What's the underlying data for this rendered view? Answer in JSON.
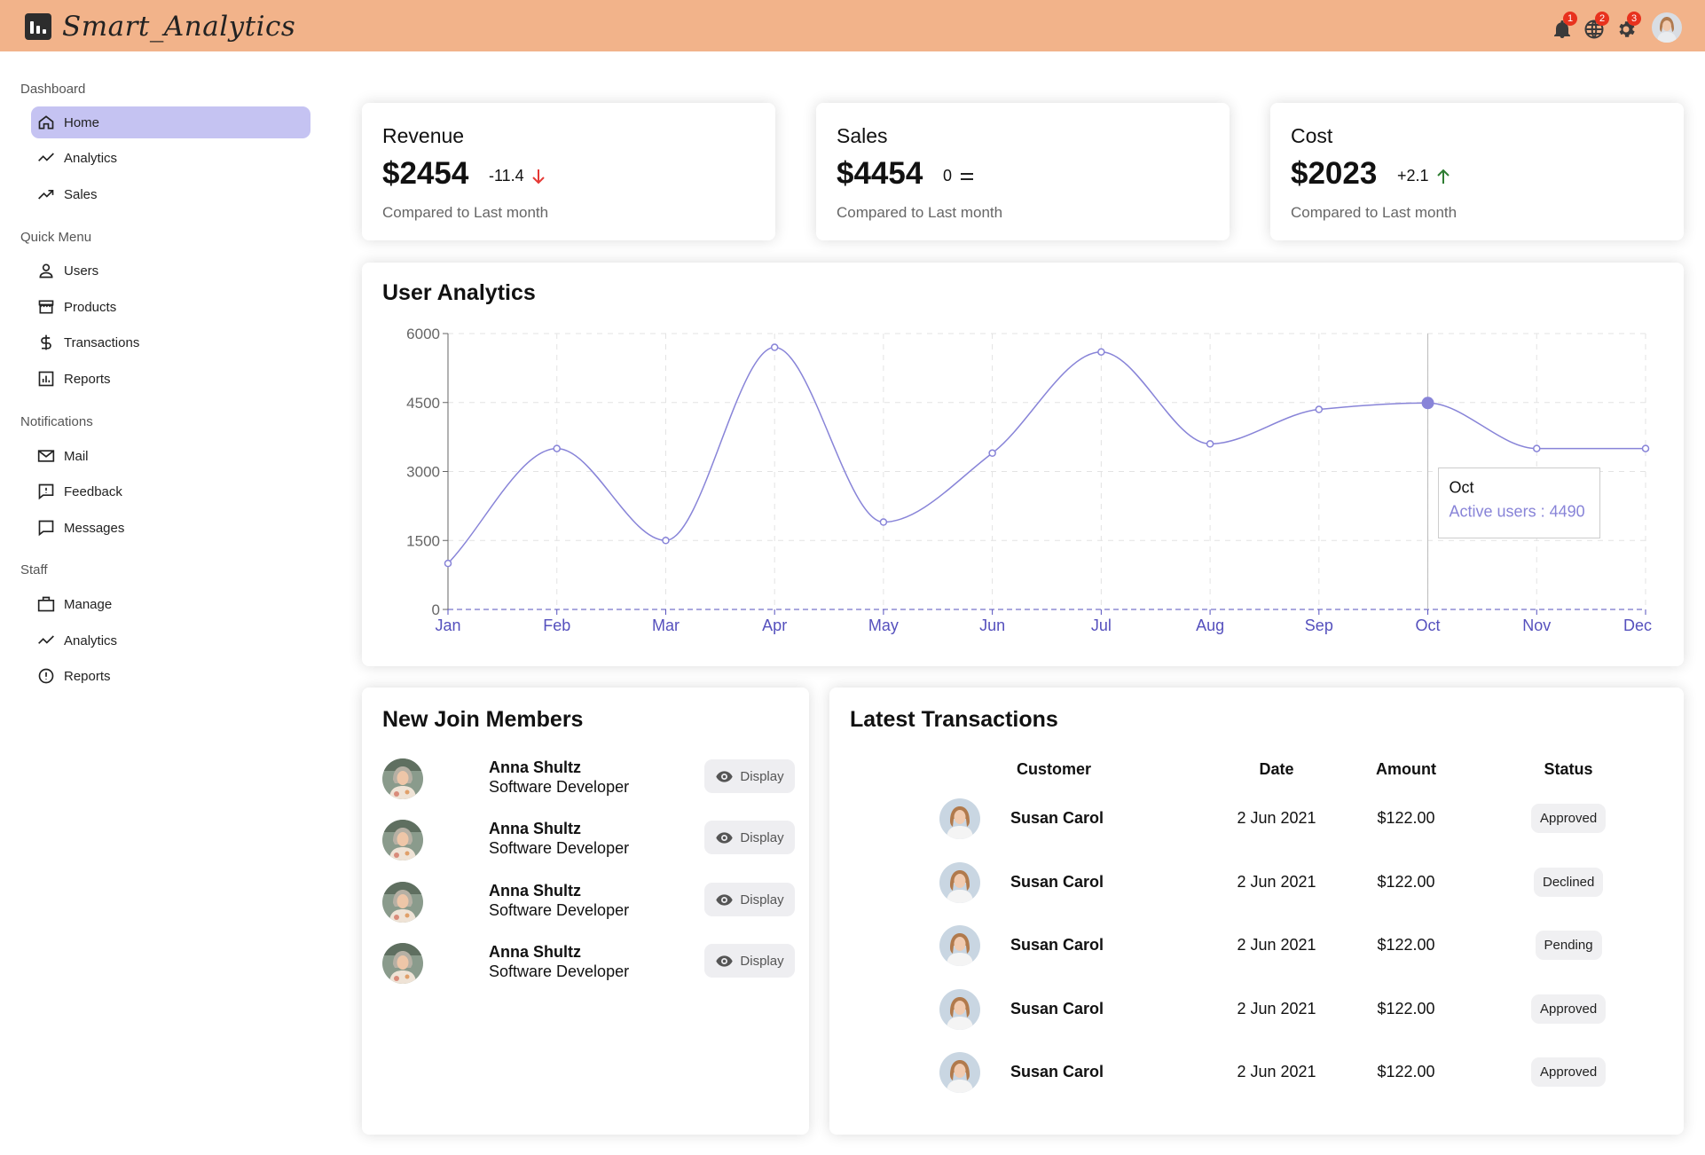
{
  "topbar": {
    "brand": "Smart_Analytics",
    "notifications": [
      {
        "icon": "bell-icon",
        "count": "1"
      },
      {
        "icon": "globe-icon",
        "count": "2"
      },
      {
        "icon": "gear-icon",
        "count": "3"
      }
    ],
    "accent_color": "#f2b38a"
  },
  "sidebar": {
    "sections": [
      {
        "title": "Dashboard",
        "items": [
          {
            "label": "Home",
            "icon": "home-icon",
            "active": true
          },
          {
            "label": "Analytics",
            "icon": "trend-line-icon"
          },
          {
            "label": "Sales",
            "icon": "trend-up-icon"
          }
        ]
      },
      {
        "title": "Quick Menu",
        "items": [
          {
            "label": "Users",
            "icon": "user-icon"
          },
          {
            "label": "Products",
            "icon": "store-icon"
          },
          {
            "label": "Transactions",
            "icon": "dollar-icon"
          },
          {
            "label": "Reports",
            "icon": "bar-chart-icon"
          }
        ]
      },
      {
        "title": "Notifications",
        "items": [
          {
            "label": "Mail",
            "icon": "mail-icon"
          },
          {
            "label": "Feedback",
            "icon": "feedback-icon"
          },
          {
            "label": "Messages",
            "icon": "message-icon"
          }
        ]
      },
      {
        "title": "Staff",
        "items": [
          {
            "label": "Manage",
            "icon": "briefcase-icon"
          },
          {
            "label": "Analytics",
            "icon": "trend-line-icon"
          },
          {
            "label": "Reports",
            "icon": "alert-circle-icon"
          }
        ]
      }
    ],
    "active_color": "#c5c3f2"
  },
  "kpis": [
    {
      "title": "Revenue",
      "value": "$2454",
      "delta": "-11.4",
      "trend": "down",
      "subtitle": "Compared to Last month"
    },
    {
      "title": "Sales",
      "value": "$4454",
      "delta": "0",
      "trend": "flat",
      "subtitle": "Compared to Last month"
    },
    {
      "title": "Cost",
      "value": "$2023",
      "delta": "+2.1",
      "trend": "up",
      "subtitle": "Compared to Last month"
    }
  ],
  "chart_data": {
    "type": "line",
    "title": "User Analytics",
    "categories": [
      "Jan",
      "Feb",
      "Mar",
      "Apr",
      "May",
      "Jun",
      "Jul",
      "Aug",
      "Sep",
      "Oct",
      "Nov",
      "Dec"
    ],
    "series": [
      {
        "name": "Active users",
        "values": [
          1000,
          3500,
          1500,
          5700,
          1900,
          3400,
          5600,
          3600,
          4350,
          4490,
          3500,
          3500
        ],
        "color": "#8884d8"
      }
    ],
    "ylim": [
      0,
      6000
    ],
    "yticks": [
      0,
      1500,
      3000,
      4500,
      6000
    ],
    "grid": true,
    "tooltip": {
      "category": "Oct",
      "label": "Active users : 4490"
    },
    "axis_color": "#5550bd"
  },
  "members": {
    "title": "New Join Members",
    "button_label": "Display",
    "items": [
      {
        "name": "Anna Shultz",
        "role": "Software Developer"
      },
      {
        "name": "Anna Shultz",
        "role": "Software Developer"
      },
      {
        "name": "Anna Shultz",
        "role": "Software Developer"
      },
      {
        "name": "Anna Shultz",
        "role": "Software Developer"
      }
    ]
  },
  "transactions": {
    "title": "Latest Transactions",
    "headers": {
      "customer": "Customer",
      "date": "Date",
      "amount": "Amount",
      "status": "Status"
    },
    "rows": [
      {
        "customer": "Susan Carol",
        "date": "2 Jun 2021",
        "amount": "$122.00",
        "status": "Approved"
      },
      {
        "customer": "Susan Carol",
        "date": "2 Jun 2021",
        "amount": "$122.00",
        "status": "Declined"
      },
      {
        "customer": "Susan Carol",
        "date": "2 Jun 2021",
        "amount": "$122.00",
        "status": "Pending"
      },
      {
        "customer": "Susan Carol",
        "date": "2 Jun 2021",
        "amount": "$122.00",
        "status": "Approved"
      },
      {
        "customer": "Susan Carol",
        "date": "2 Jun 2021",
        "amount": "$122.00",
        "status": "Approved"
      }
    ]
  }
}
